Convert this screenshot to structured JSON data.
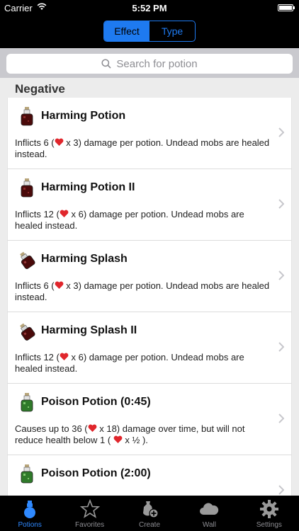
{
  "status": {
    "carrier": "Carrier",
    "time": "5:52 PM",
    "battery_level": 1.0
  },
  "segmented": {
    "effect": "Effect",
    "type": "Type",
    "selected": "Effect"
  },
  "search": {
    "placeholder": "Search for potion"
  },
  "section": {
    "title": "Negative"
  },
  "potions": [
    {
      "title": "Harming Potion",
      "icon": "harming-potion-icon",
      "text_before": "Inflicts 6 (",
      "text_after": " x 3) damage per potion.  Undead mobs are healed instead."
    },
    {
      "title": "Harming Potion II",
      "icon": "harming-potion-icon",
      "text_before": "Inflicts 12 (",
      "text_after": " x 6) damage per potion.  Undead mobs are healed instead."
    },
    {
      "title": "Harming Splash",
      "icon": "harming-splash-icon",
      "text_before": "Inflicts 6 (",
      "text_after": " x 3) damage per potion.  Undead mobs are healed instead."
    },
    {
      "title": "Harming Splash II",
      "icon": "harming-splash-icon",
      "text_before": "Inflicts 12 (",
      "text_after": " x 6) damage per potion.  Undead mobs are healed instead."
    },
    {
      "title": "Poison Potion (0:45)",
      "icon": "poison-potion-icon",
      "text_before": "Causes up to 36 (",
      "text_after": " x 18) damage over time, but will not reduce health below 1 ( ",
      "text_end": " x ½ )."
    },
    {
      "title": "Poison Potion (2:00)",
      "icon": "poison-potion-icon",
      "text_before": "",
      "text_after": ""
    }
  ],
  "tabs": [
    {
      "label": "Potions",
      "icon": "potion-tab-icon",
      "active": true
    },
    {
      "label": "Favorites",
      "icon": "star-icon",
      "active": false
    },
    {
      "label": "Create",
      "icon": "create-icon",
      "active": false
    },
    {
      "label": "Wall",
      "icon": "cloud-icon",
      "active": false
    },
    {
      "label": "Settings",
      "icon": "gear-icon",
      "active": false
    }
  ],
  "colors": {
    "accent": "#1e7af0",
    "heart": "#e0262c",
    "harming_liquid": "#4a0a0a",
    "poison_liquid": "#2f7a2a"
  }
}
